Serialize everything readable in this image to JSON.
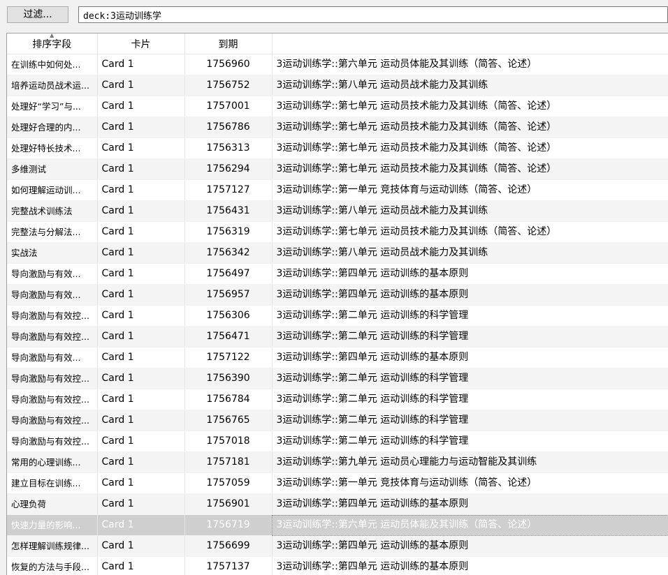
{
  "toolbar": {
    "filter_label": "过滤...",
    "search_value": "deck:3运动训练学"
  },
  "table": {
    "columns": [
      "排序字段",
      "卡片",
      "到期",
      ""
    ],
    "rows": [
      {
        "sort": "在训练中如何处...",
        "card": "Card 1",
        "due": "1756960",
        "deck": "3运动训练学::第六单元 运动员体能及其训练（简答、论述）"
      },
      {
        "sort": "培养运动员战术运...",
        "card": "Card 1",
        "due": "1756752",
        "deck": "3运动训练学::第八单元 运动员战术能力及其训练"
      },
      {
        "sort": "处理好“学习”与...",
        "card": "Card 1",
        "due": "1757001",
        "deck": "3运动训练学::第七单元 运动员技术能力及其训练（简答、论述）"
      },
      {
        "sort": "处理好合理的内...",
        "card": "Card 1",
        "due": "1756786",
        "deck": "3运动训练学::第七单元 运动员技术能力及其训练（简答、论述）"
      },
      {
        "sort": "处理好特长技术...",
        "card": "Card 1",
        "due": "1756313",
        "deck": "3运动训练学::第七单元 运动员技术能力及其训练（简答、论述）"
      },
      {
        "sort": "多维测试",
        "card": "Card 1",
        "due": "1756294",
        "deck": "3运动训练学::第七单元 运动员技术能力及其训练（简答、论述）"
      },
      {
        "sort": "如何理解运动训...",
        "card": "Card 1",
        "due": "1757127",
        "deck": "3运动训练学::第一单元 竞技体育与运动训练（简答、论述）"
      },
      {
        "sort": "完整战术训练法",
        "card": "Card 1",
        "due": "1756431",
        "deck": "3运动训练学::第八单元 运动员战术能力及其训练"
      },
      {
        "sort": "完整法与分解法...",
        "card": "Card 1",
        "due": "1756319",
        "deck": "3运动训练学::第七单元 运动员技术能力及其训练（简答、论述）"
      },
      {
        "sort": "实战法",
        "card": "Card 1",
        "due": "1756342",
        "deck": "3运动训练学::第八单元 运动员战术能力及其训练"
      },
      {
        "sort": "导向激励与有效...",
        "card": "Card 1",
        "due": "1756497",
        "deck": "3运动训练学::第四单元 运动训练的基本原则"
      },
      {
        "sort": "导向激励与有效...",
        "card": "Card 1",
        "due": "1756957",
        "deck": "3运动训练学::第四单元 运动训练的基本原则"
      },
      {
        "sort": "导向激励与有效控...",
        "card": "Card 1",
        "due": "1756306",
        "deck": "3运动训练学::第二单元 运动训练的科学管理"
      },
      {
        "sort": "导向激励与有效控...",
        "card": "Card 1",
        "due": "1756471",
        "deck": "3运动训练学::第二单元 运动训练的科学管理"
      },
      {
        "sort": "导向激励与有效...",
        "card": "Card 1",
        "due": "1757122",
        "deck": "3运动训练学::第四单元 运动训练的基本原则"
      },
      {
        "sort": "导向激励与有效控...",
        "card": "Card 1",
        "due": "1756390",
        "deck": "3运动训练学::第二单元 运动训练的科学管理"
      },
      {
        "sort": "导向激励与有效控...",
        "card": "Card 1",
        "due": "1756784",
        "deck": "3运动训练学::第二单元 运动训练的科学管理"
      },
      {
        "sort": "导向激励与有效控...",
        "card": "Card 1",
        "due": "1756765",
        "deck": "3运动训练学::第二单元 运动训练的科学管理"
      },
      {
        "sort": "导向激励与有效控...",
        "card": "Card 1",
        "due": "1757018",
        "deck": "3运动训练学::第二单元 运动训练的科学管理"
      },
      {
        "sort": "常用的心理训练...",
        "card": "Card 1",
        "due": "1757181",
        "deck": "3运动训练学::第九单元 运动员心理能力与运动智能及其训练"
      },
      {
        "sort": "建立目标在训练...",
        "card": "Card 1",
        "due": "1757059",
        "deck": "3运动训练学::第一单元 竞技体育与运动训练（简答、论述）"
      },
      {
        "sort": "心理负荷",
        "card": "Card 1",
        "due": "1756901",
        "deck": "3运动训练学::第四单元 运动训练的基本原则"
      },
      {
        "sort": "快速力量的影响...",
        "card": "Card 1",
        "due": "1756719",
        "deck": "3运动训练学::第六单元 运动员体能及其训练（简答、论述）"
      },
      {
        "sort": "怎样理解训练规律...",
        "card": "Card 1",
        "due": "1756699",
        "deck": "3运动训练学::第四单元 运动训练的基本原则"
      },
      {
        "sort": "恢复的方法与手段...",
        "card": "Card 1",
        "due": "1757137",
        "deck": "3运动训练学::第四单元 运动训练的基本原则"
      }
    ]
  },
  "selected_row_index": 22
}
